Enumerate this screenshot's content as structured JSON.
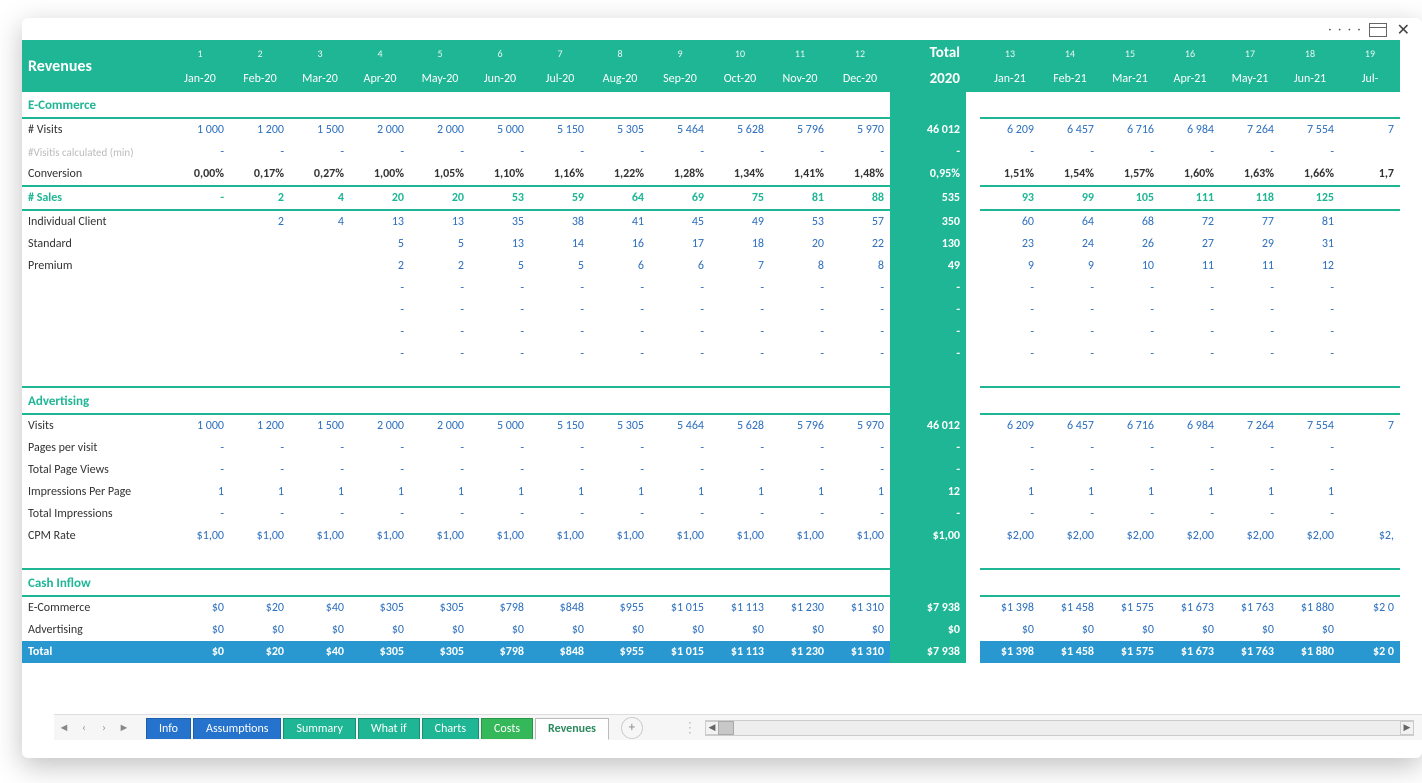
{
  "title": "Revenues",
  "totalHeader": {
    "label": "Total",
    "year": "2020"
  },
  "months20": [
    {
      "n": "1",
      "lbl": "Jan-20"
    },
    {
      "n": "2",
      "lbl": "Feb-20"
    },
    {
      "n": "3",
      "lbl": "Mar-20"
    },
    {
      "n": "4",
      "lbl": "Apr-20"
    },
    {
      "n": "5",
      "lbl": "May-20"
    },
    {
      "n": "6",
      "lbl": "Jun-20"
    },
    {
      "n": "7",
      "lbl": "Jul-20"
    },
    {
      "n": "8",
      "lbl": "Aug-20"
    },
    {
      "n": "9",
      "lbl": "Sep-20"
    },
    {
      "n": "10",
      "lbl": "Oct-20"
    },
    {
      "n": "11",
      "lbl": "Nov-20"
    },
    {
      "n": "12",
      "lbl": "Dec-20"
    }
  ],
  "months21": [
    {
      "n": "13",
      "lbl": "Jan-21"
    },
    {
      "n": "14",
      "lbl": "Feb-21"
    },
    {
      "n": "15",
      "lbl": "Mar-21"
    },
    {
      "n": "16",
      "lbl": "Apr-21"
    },
    {
      "n": "17",
      "lbl": "May-21"
    },
    {
      "n": "18",
      "lbl": "Jun-21"
    },
    {
      "n": "19",
      "lbl": "Jul-"
    }
  ],
  "sections": {
    "ecommerce": "E-Commerce",
    "advertising": "Advertising",
    "cashInflow": "Cash Inflow"
  },
  "rows": {
    "visits": {
      "label": "# Visits",
      "v20": [
        "1 000",
        "1 200",
        "1 500",
        "2 000",
        "2 000",
        "5 000",
        "5 150",
        "5 305",
        "5 464",
        "5 628",
        "5 796",
        "5 970"
      ],
      "tot": "46 012",
      "v21": [
        "6 209",
        "6 457",
        "6 716",
        "6 984",
        "7 264",
        "7 554",
        "7"
      ]
    },
    "visitsCalc": {
      "label": "#Visitis calculated (min)",
      "v20": [
        "-",
        "-",
        "-",
        "-",
        "-",
        "-",
        "-",
        "-",
        "-",
        "-",
        "-",
        "-"
      ],
      "tot": "-",
      "v21": [
        "-",
        "-",
        "-",
        "-",
        "-",
        "-",
        ""
      ]
    },
    "conv": {
      "label": "Conversion",
      "v20": [
        "0,00%",
        "0,17%",
        "0,27%",
        "1,00%",
        "1,05%",
        "1,10%",
        "1,16%",
        "1,22%",
        "1,28%",
        "1,34%",
        "1,41%",
        "1,48%"
      ],
      "tot": "0,95%",
      "v21": [
        "1,51%",
        "1,54%",
        "1,57%",
        "1,60%",
        "1,63%",
        "1,66%",
        "1,7"
      ]
    },
    "sales": {
      "label": "# Sales",
      "v20": [
        "-",
        "2",
        "4",
        "20",
        "20",
        "53",
        "59",
        "64",
        "69",
        "75",
        "81",
        "88"
      ],
      "tot": "535",
      "v21": [
        "93",
        "99",
        "105",
        "111",
        "118",
        "125",
        ""
      ]
    },
    "ind": {
      "label": "Individual Client",
      "v20": [
        "",
        "2",
        "4",
        "13",
        "13",
        "35",
        "38",
        "41",
        "45",
        "49",
        "53",
        "57"
      ],
      "tot": "350",
      "v21": [
        "60",
        "64",
        "68",
        "72",
        "77",
        "81",
        ""
      ]
    },
    "std": {
      "label": "Standard",
      "v20": [
        "",
        "",
        "",
        "5",
        "5",
        "13",
        "14",
        "16",
        "17",
        "18",
        "20",
        "22"
      ],
      "tot": "130",
      "v21": [
        "23",
        "24",
        "26",
        "27",
        "29",
        "31",
        ""
      ]
    },
    "prem": {
      "label": "Premium",
      "v20": [
        "",
        "",
        "",
        "2",
        "2",
        "5",
        "5",
        "6",
        "6",
        "7",
        "8",
        "8"
      ],
      "tot": "49",
      "v21": [
        "9",
        "9",
        "10",
        "11",
        "11",
        "12",
        ""
      ]
    },
    "bl1": {
      "label": "",
      "v20": [
        "",
        "",
        "",
        "-",
        "-",
        "-",
        "-",
        "-",
        "-",
        "-",
        "-",
        "-"
      ],
      "tot": "-",
      "v21": [
        "-",
        "-",
        "-",
        "-",
        "-",
        "-",
        ""
      ]
    },
    "bl2": {
      "label": "",
      "v20": [
        "",
        "",
        "",
        "-",
        "-",
        "-",
        "-",
        "-",
        "-",
        "-",
        "-",
        "-"
      ],
      "tot": "-",
      "v21": [
        "-",
        "-",
        "-",
        "-",
        "-",
        "-",
        ""
      ]
    },
    "bl3": {
      "label": "",
      "v20": [
        "",
        "",
        "",
        "-",
        "-",
        "-",
        "-",
        "-",
        "-",
        "-",
        "-",
        "-"
      ],
      "tot": "-",
      "v21": [
        "-",
        "-",
        "-",
        "-",
        "-",
        "-",
        ""
      ]
    },
    "bl4": {
      "label": "",
      "v20": [
        "",
        "",
        "",
        "-",
        "-",
        "-",
        "-",
        "-",
        "-",
        "-",
        "-",
        "-"
      ],
      "tot": "-",
      "v21": [
        "-",
        "-",
        "-",
        "-",
        "-",
        "-",
        ""
      ]
    },
    "advVisits": {
      "label": "Visits",
      "v20": [
        "1 000",
        "1 200",
        "1 500",
        "2 000",
        "2 000",
        "5 000",
        "5 150",
        "5 305",
        "5 464",
        "5 628",
        "5 796",
        "5 970"
      ],
      "tot": "46 012",
      "v21": [
        "6 209",
        "6 457",
        "6 716",
        "6 984",
        "7 264",
        "7 554",
        "7"
      ]
    },
    "ppv": {
      "label": "Pages per visit",
      "v20": [
        "-",
        "-",
        "-",
        "-",
        "-",
        "-",
        "-",
        "-",
        "-",
        "-",
        "-",
        "-"
      ],
      "tot": "-",
      "v21": [
        "-",
        "-",
        "-",
        "-",
        "-",
        "-",
        ""
      ]
    },
    "tpv": {
      "label": "Total Page Views",
      "v20": [
        "-",
        "-",
        "-",
        "-",
        "-",
        "-",
        "-",
        "-",
        "-",
        "-",
        "-",
        "-"
      ],
      "tot": "-",
      "v21": [
        "-",
        "-",
        "-",
        "-",
        "-",
        "-",
        ""
      ]
    },
    "ipp": {
      "label": "Impressions Per Page",
      "v20": [
        "1",
        "1",
        "1",
        "1",
        "1",
        "1",
        "1",
        "1",
        "1",
        "1",
        "1",
        "1"
      ],
      "tot": "12",
      "v21": [
        "1",
        "1",
        "1",
        "1",
        "1",
        "1",
        ""
      ]
    },
    "timp": {
      "label": "Total Impressions",
      "v20": [
        "-",
        "-",
        "-",
        "-",
        "-",
        "-",
        "-",
        "-",
        "-",
        "-",
        "-",
        "-"
      ],
      "tot": "-",
      "v21": [
        "-",
        "-",
        "-",
        "-",
        "-",
        "-",
        ""
      ]
    },
    "cpm": {
      "label": "CPM Rate",
      "v20": [
        "$1,00",
        "$1,00",
        "$1,00",
        "$1,00",
        "$1,00",
        "$1,00",
        "$1,00",
        "$1,00",
        "$1,00",
        "$1,00",
        "$1,00",
        "$1,00"
      ],
      "tot": "$1,00",
      "v21": [
        "$2,00",
        "$2,00",
        "$2,00",
        "$2,00",
        "$2,00",
        "$2,00",
        "$2,"
      ]
    },
    "ciEcom": {
      "label": "E-Commerce",
      "v20": [
        "$0",
        "$20",
        "$40",
        "$305",
        "$305",
        "$798",
        "$848",
        "$955",
        "$1 015",
        "$1 113",
        "$1 230",
        "$1 310"
      ],
      "tot": "$7 938",
      "v21": [
        "$1 398",
        "$1 458",
        "$1 575",
        "$1 673",
        "$1 763",
        "$1 880",
        "$2 0"
      ]
    },
    "ciAdv": {
      "label": "Advertising",
      "v20": [
        "$0",
        "$0",
        "$0",
        "$0",
        "$0",
        "$0",
        "$0",
        "$0",
        "$0",
        "$0",
        "$0",
        "$0"
      ],
      "tot": "$0",
      "v21": [
        "$0",
        "$0",
        "$0",
        "$0",
        "$0",
        "$0",
        ""
      ]
    },
    "total": {
      "label": "Total",
      "v20": [
        "$0",
        "$20",
        "$40",
        "$305",
        "$305",
        "$798",
        "$848",
        "$955",
        "$1 015",
        "$1 113",
        "$1 230",
        "$1 310"
      ],
      "tot": "$7 938",
      "v21": [
        "$1 398",
        "$1 458",
        "$1 575",
        "$1 673",
        "$1 763",
        "$1 880",
        "$2 0"
      ]
    }
  },
  "tabs": [
    "Info",
    "Assumptions",
    "Summary",
    "What if",
    "Charts",
    "Costs",
    "Revenues"
  ],
  "activeTab": "Revenues"
}
